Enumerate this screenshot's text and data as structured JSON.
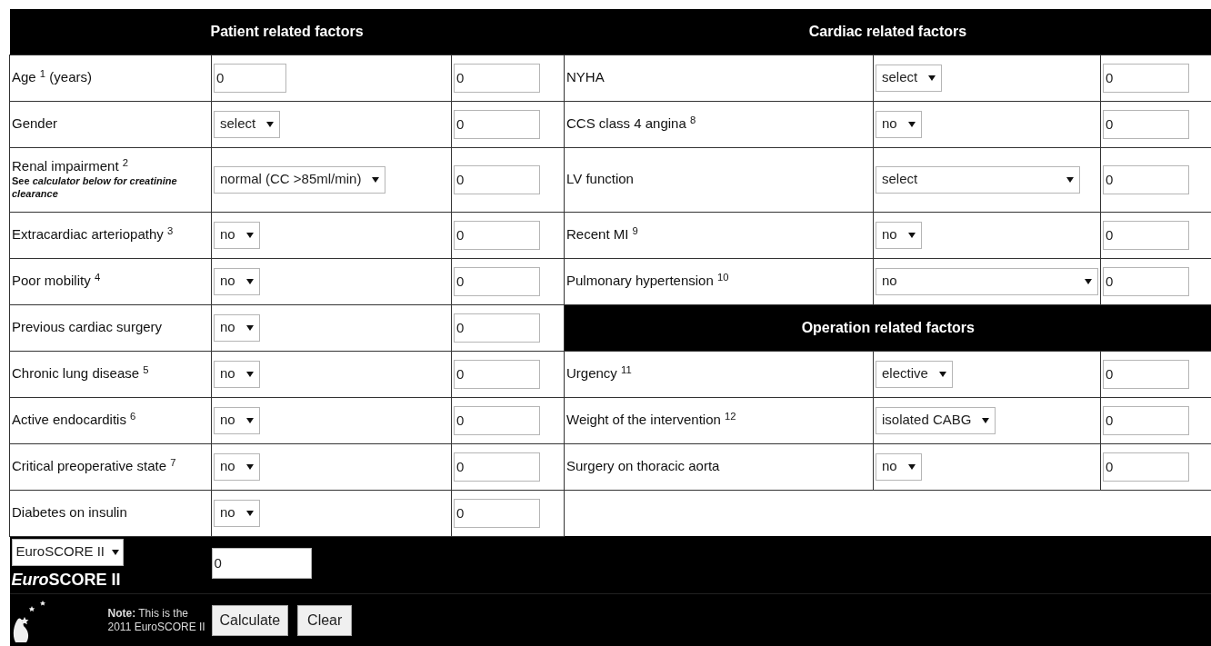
{
  "patient": {
    "title": "Patient related factors",
    "rows": [
      {
        "label": "Age $^{1}$ (years)",
        "kind": "input",
        "value": "0",
        "score": "0"
      },
      {
        "label": "Gender",
        "kind": "select",
        "value": "select",
        "score": "0"
      },
      {
        "label": "Renal impairment $^{2}$",
        "note": "See *calculator below for creatinine clearance*",
        "kind": "select",
        "value": "normal (CC >85ml/min)",
        "score": "0"
      },
      {
        "label": "Extracardiac arteriopathy $^{3}$",
        "kind": "select",
        "value": "no",
        "score": "0"
      },
      {
        "label": "Poor mobility $^{4}$",
        "kind": "select",
        "value": "no",
        "score": "0"
      },
      {
        "label": "Previous cardiac surgery",
        "kind": "select",
        "value": "no",
        "score": "0"
      },
      {
        "label": "Chronic lung disease $^{5}$",
        "kind": "select",
        "value": "no",
        "score": "0"
      },
      {
        "label": "Active endocarditis $^{6}$",
        "kind": "select",
        "value": "no",
        "score": "0"
      },
      {
        "label": "Critical preoperative state $^{7}$",
        "kind": "select",
        "value": "no",
        "score": "0"
      },
      {
        "label": "Diabetes on insulin",
        "kind": "select",
        "value": "no",
        "score": "0"
      }
    ]
  },
  "sections": [
    {
      "title": "Cardiac related factors",
      "rows": [
        {
          "label": "NYHA",
          "kind": "select",
          "value": "select",
          "score": "0"
        },
        {
          "label": "CCS class 4 angina $^{8}$",
          "kind": "select",
          "value": "no",
          "score": "0"
        },
        {
          "label": "LV function",
          "kind": "wide-select",
          "value": "select",
          "score": "0"
        },
        {
          "label": "Recent MI $^{9}$",
          "kind": "select",
          "value": "no",
          "score": "0"
        },
        {
          "label": "Pulmonary hypertension $^{10}$",
          "kind": "full-select",
          "value": "no",
          "score": "0"
        }
      ]
    },
    {
      "title": "Operation related factors",
      "rows": [
        {
          "label": "Urgency $^{11}$",
          "kind": "select",
          "value": "elective",
          "score": "0"
        },
        {
          "label": "Weight of the intervention $^{12}$",
          "kind": "select",
          "value": "isolated CABG",
          "score": "0"
        },
        {
          "label": "Surgery on thoracic aorta",
          "kind": "select",
          "value": "no",
          "score": "0"
        }
      ]
    }
  ],
  "footer": {
    "model": "EuroSCORE II",
    "title": {
      "italic": "Euro",
      "rest": "SCORE II"
    },
    "result": "0",
    "note": "**Note:** This is the 2011 EuroSCORE II",
    "buttons": [
      "Calculate",
      "Clear"
    ]
  }
}
